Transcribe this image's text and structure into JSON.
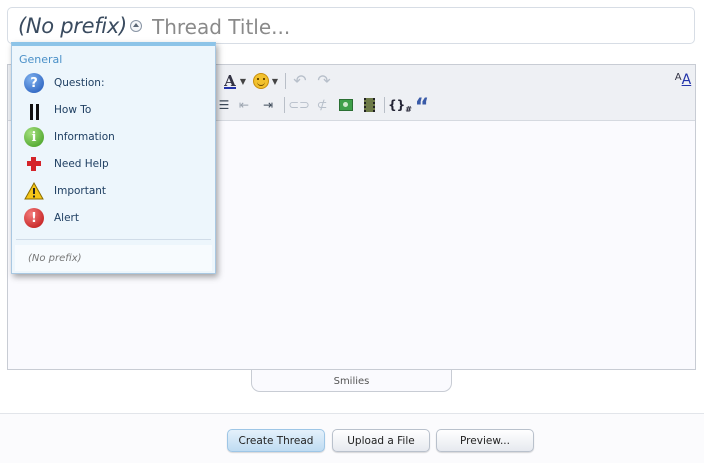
{
  "thread": {
    "prefix_label": "(No prefix)",
    "title_placeholder": "Thread Title..."
  },
  "prefix_menu": {
    "group_label": "General",
    "items": [
      {
        "label": "Question:",
        "icon": "question-icon"
      },
      {
        "label": "How To",
        "icon": "tools-icon"
      },
      {
        "label": "Information",
        "icon": "info-icon"
      },
      {
        "label": "Need Help",
        "icon": "red-cross-icon"
      },
      {
        "label": "Important",
        "icon": "warning-icon"
      },
      {
        "label": "Alert",
        "icon": "alert-icon"
      }
    ],
    "no_prefix_label": "(No prefix)"
  },
  "toolbar": {
    "font_color_glyph": "A",
    "undo_glyph": "↶",
    "redo_glyph": "↷",
    "remove_format_glyph": "A",
    "code_glyph": "{}",
    "code_sub_glyph": "#",
    "quote_glyph": "“"
  },
  "editor": {
    "smilies_tab": "Smilies"
  },
  "actions": {
    "create_thread": "Create Thread",
    "upload_file": "Upload a File",
    "preview": "Preview..."
  },
  "colors": {
    "primary_button": "#bfdcf2",
    "menu_accent": "#8dc4e8",
    "menu_text": "#1f3f62"
  }
}
